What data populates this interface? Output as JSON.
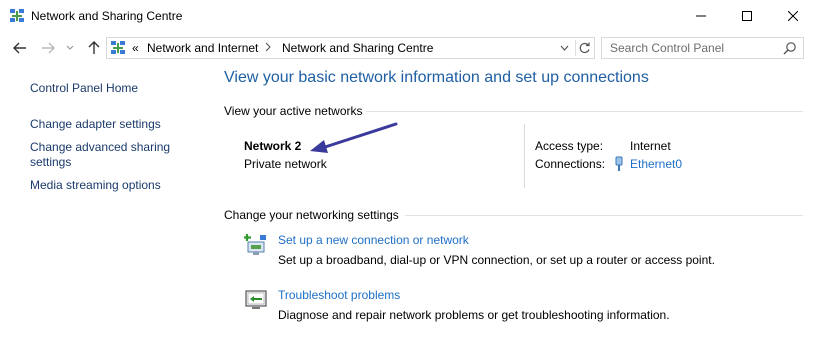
{
  "window": {
    "title": "Network and Sharing Centre"
  },
  "address_bar": {
    "overflow": "«",
    "crumbs": [
      "Network and Internet",
      "Network and Sharing Centre"
    ],
    "search_placeholder": "Search Control Panel"
  },
  "sidebar": {
    "items": [
      {
        "label": "Control Panel Home"
      },
      {
        "label": "Change adapter settings"
      },
      {
        "label": "Change advanced sharing"
      },
      {
        "label": "settings"
      },
      {
        "label": "Media streaming options"
      }
    ]
  },
  "main": {
    "heading": "View your basic network information and set up connections",
    "active_networks_title": "View your active networks",
    "network": {
      "name": "Network 2",
      "type": "Private network",
      "access_type_label": "Access type:",
      "access_type_value": "Internet",
      "connections_label": "Connections:",
      "connections_value": "Ethernet0"
    },
    "change_settings_title": "Change your networking settings",
    "tasks": [
      {
        "link": "Set up a new connection or network",
        "description": "Set up a broadband, dial-up or VPN connection, or set up a router or access point."
      },
      {
        "link": "Troubleshoot problems",
        "description": "Diagnose and repair network problems or get troubleshooting information."
      }
    ]
  },
  "colors": {
    "heading": "#1e5fa3",
    "link": "#1e6fc7",
    "annotation_arrow": "#3a3a9c"
  }
}
